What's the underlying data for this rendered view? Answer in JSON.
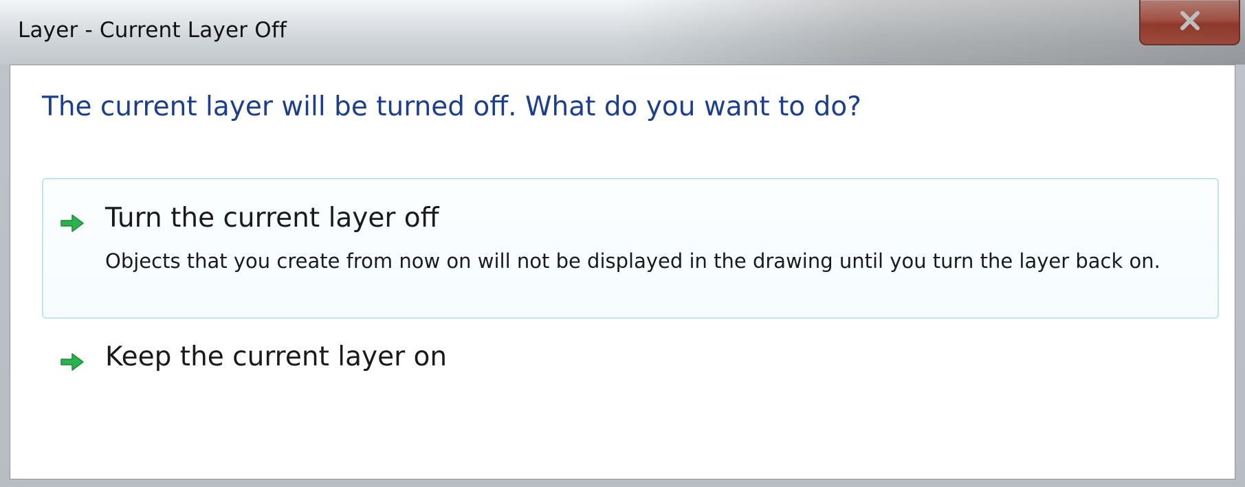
{
  "window": {
    "title": "Layer - Current Layer Off",
    "close_icon": "close-x-icon"
  },
  "dialog": {
    "instruction": "The current layer will be turned off. What do you want to do?",
    "options": [
      {
        "icon": "green-arrow-icon",
        "title": "Turn the current layer off",
        "description": "Objects that you create from now on will not be displayed in the drawing until you turn the layer back on."
      },
      {
        "icon": "green-arrow-icon",
        "title": "Keep the current layer on"
      }
    ]
  },
  "colors": {
    "instruction_text": "#1a3e94",
    "arrow_green": "#2bb24c",
    "close_button_red": "#c8503b",
    "highlight_border": "#bfe6f5"
  }
}
